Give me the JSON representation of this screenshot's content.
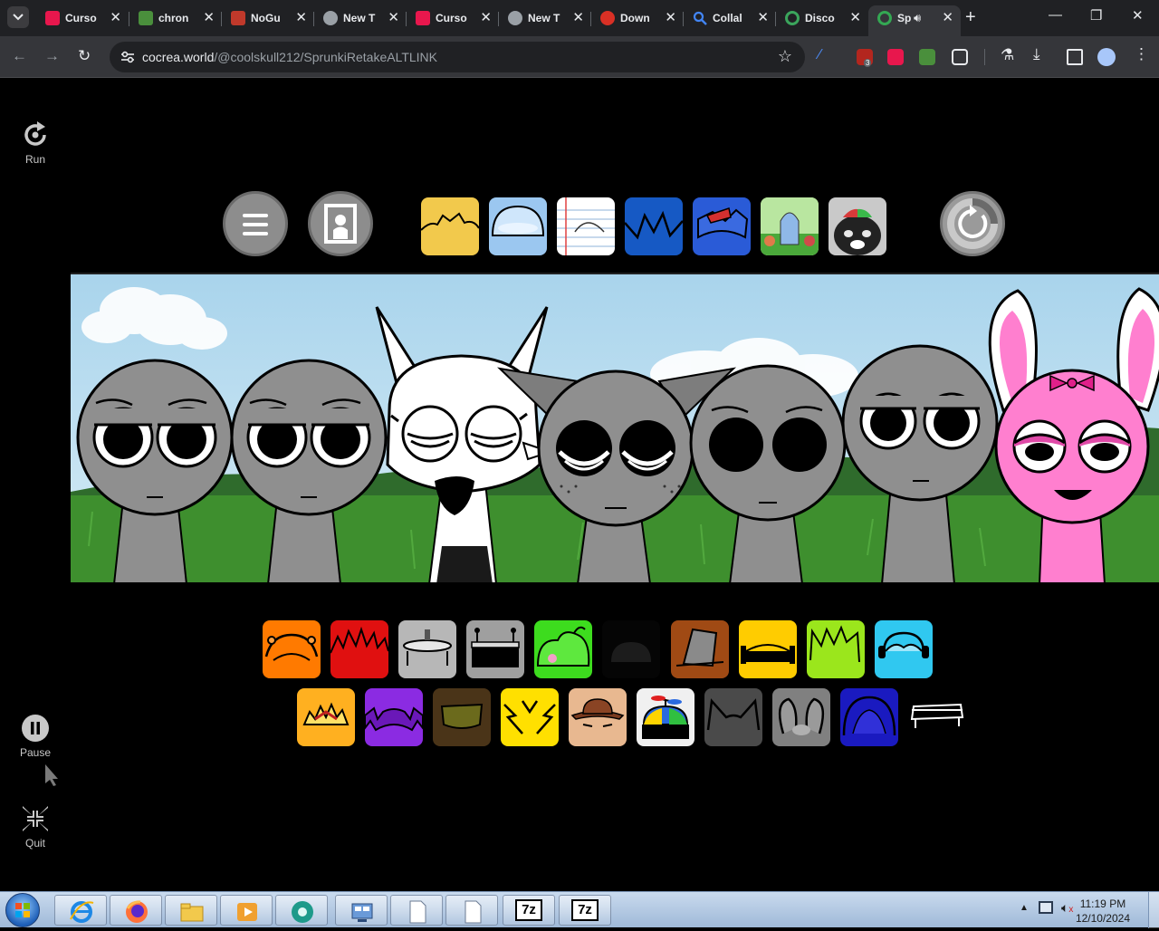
{
  "browser": {
    "tabs": [
      {
        "title": "Curso",
        "favicon_color": "#e8174d",
        "active": false
      },
      {
        "title": "chron",
        "favicon_color": "#4a8f3c",
        "active": false
      },
      {
        "title": "NoGu",
        "favicon_color": "#c0392b",
        "active": false
      },
      {
        "title": "New T",
        "favicon_color": "#9aa0a6",
        "active": false
      },
      {
        "title": "Curso",
        "favicon_color": "#e8174d",
        "active": false
      },
      {
        "title": "New T",
        "favicon_color": "#9aa0a6",
        "active": false
      },
      {
        "title": "Down",
        "favicon_color": "#d93025",
        "active": false
      },
      {
        "title": "Collal",
        "favicon_color": "#4285f4",
        "active": false
      },
      {
        "title": "Disco",
        "favicon_color": "#3ba55c",
        "active": false
      },
      {
        "title": "Sp",
        "favicon_color": "#34a853",
        "active": true
      }
    ],
    "new_tab_label": "+",
    "url_host": "cocrea.world",
    "url_path": "/@coolskull212/SprunkiRetakeALTLINK",
    "extension_badge": "3"
  },
  "sidebar": {
    "run_label": "Run",
    "pause_label": "Pause",
    "quit_label": "Quit"
  },
  "backgrounds": [
    {
      "name": "crown-yellow",
      "color": "#f2c94c"
    },
    {
      "name": "dome-lightblue",
      "color": "#9bc7f0"
    },
    {
      "name": "notebook-paper",
      "color": "#ffffff"
    },
    {
      "name": "crown-blue",
      "color": "#1659c4"
    },
    {
      "name": "broken-blue",
      "color": "#2a5bd7"
    },
    {
      "name": "garden-scene",
      "color": "#7ec850"
    },
    {
      "name": "cat-hat",
      "color": "#c9c9c9"
    }
  ],
  "sound_icons_row1": [
    {
      "name": "orange-headphones",
      "color": "#ff7a00"
    },
    {
      "name": "red-spikes",
      "color": "#e01010"
    },
    {
      "name": "gray-saucer",
      "color": "#b7b7b7"
    },
    {
      "name": "gray-antenna",
      "color": "#9f9f9f"
    },
    {
      "name": "green-bush",
      "color": "#3ddc1e"
    },
    {
      "name": "black-dome",
      "color": "#101010"
    },
    {
      "name": "brown-hat",
      "color": "#a04a14"
    },
    {
      "name": "yellow-band",
      "color": "#ffcc00"
    },
    {
      "name": "lime-spikes",
      "color": "#9be61c"
    },
    {
      "name": "cyan-headphones",
      "color": "#30c8f0"
    }
  ],
  "sound_icons_row2": [
    {
      "name": "orange-crown",
      "color": "#ffb020"
    },
    {
      "name": "purple-horns",
      "color": "#8b2be2"
    },
    {
      "name": "brown-cap",
      "color": "#4a3418"
    },
    {
      "name": "yellow-lightning",
      "color": "#ffe000"
    },
    {
      "name": "tan-cowboy",
      "color": "#e8b890"
    },
    {
      "name": "propeller-hat",
      "color": "#f0f0f0"
    },
    {
      "name": "dark-gray-ears",
      "color": "#4a4a4a"
    },
    {
      "name": "gray-bunny-ears",
      "color": "#808080"
    },
    {
      "name": "blue-hood",
      "color": "#1a1ac0"
    },
    {
      "name": "bench-outline",
      "color": "#000000"
    }
  ],
  "taskbar": {
    "time": "11:19 PM",
    "date": "12/10/2024",
    "items": [
      "ie",
      "firefox",
      "explorer",
      "media",
      "chrome",
      "control",
      "doc1",
      "doc2",
      "7z-1",
      "7z-2"
    ],
    "sevenzip_label": "7z"
  }
}
